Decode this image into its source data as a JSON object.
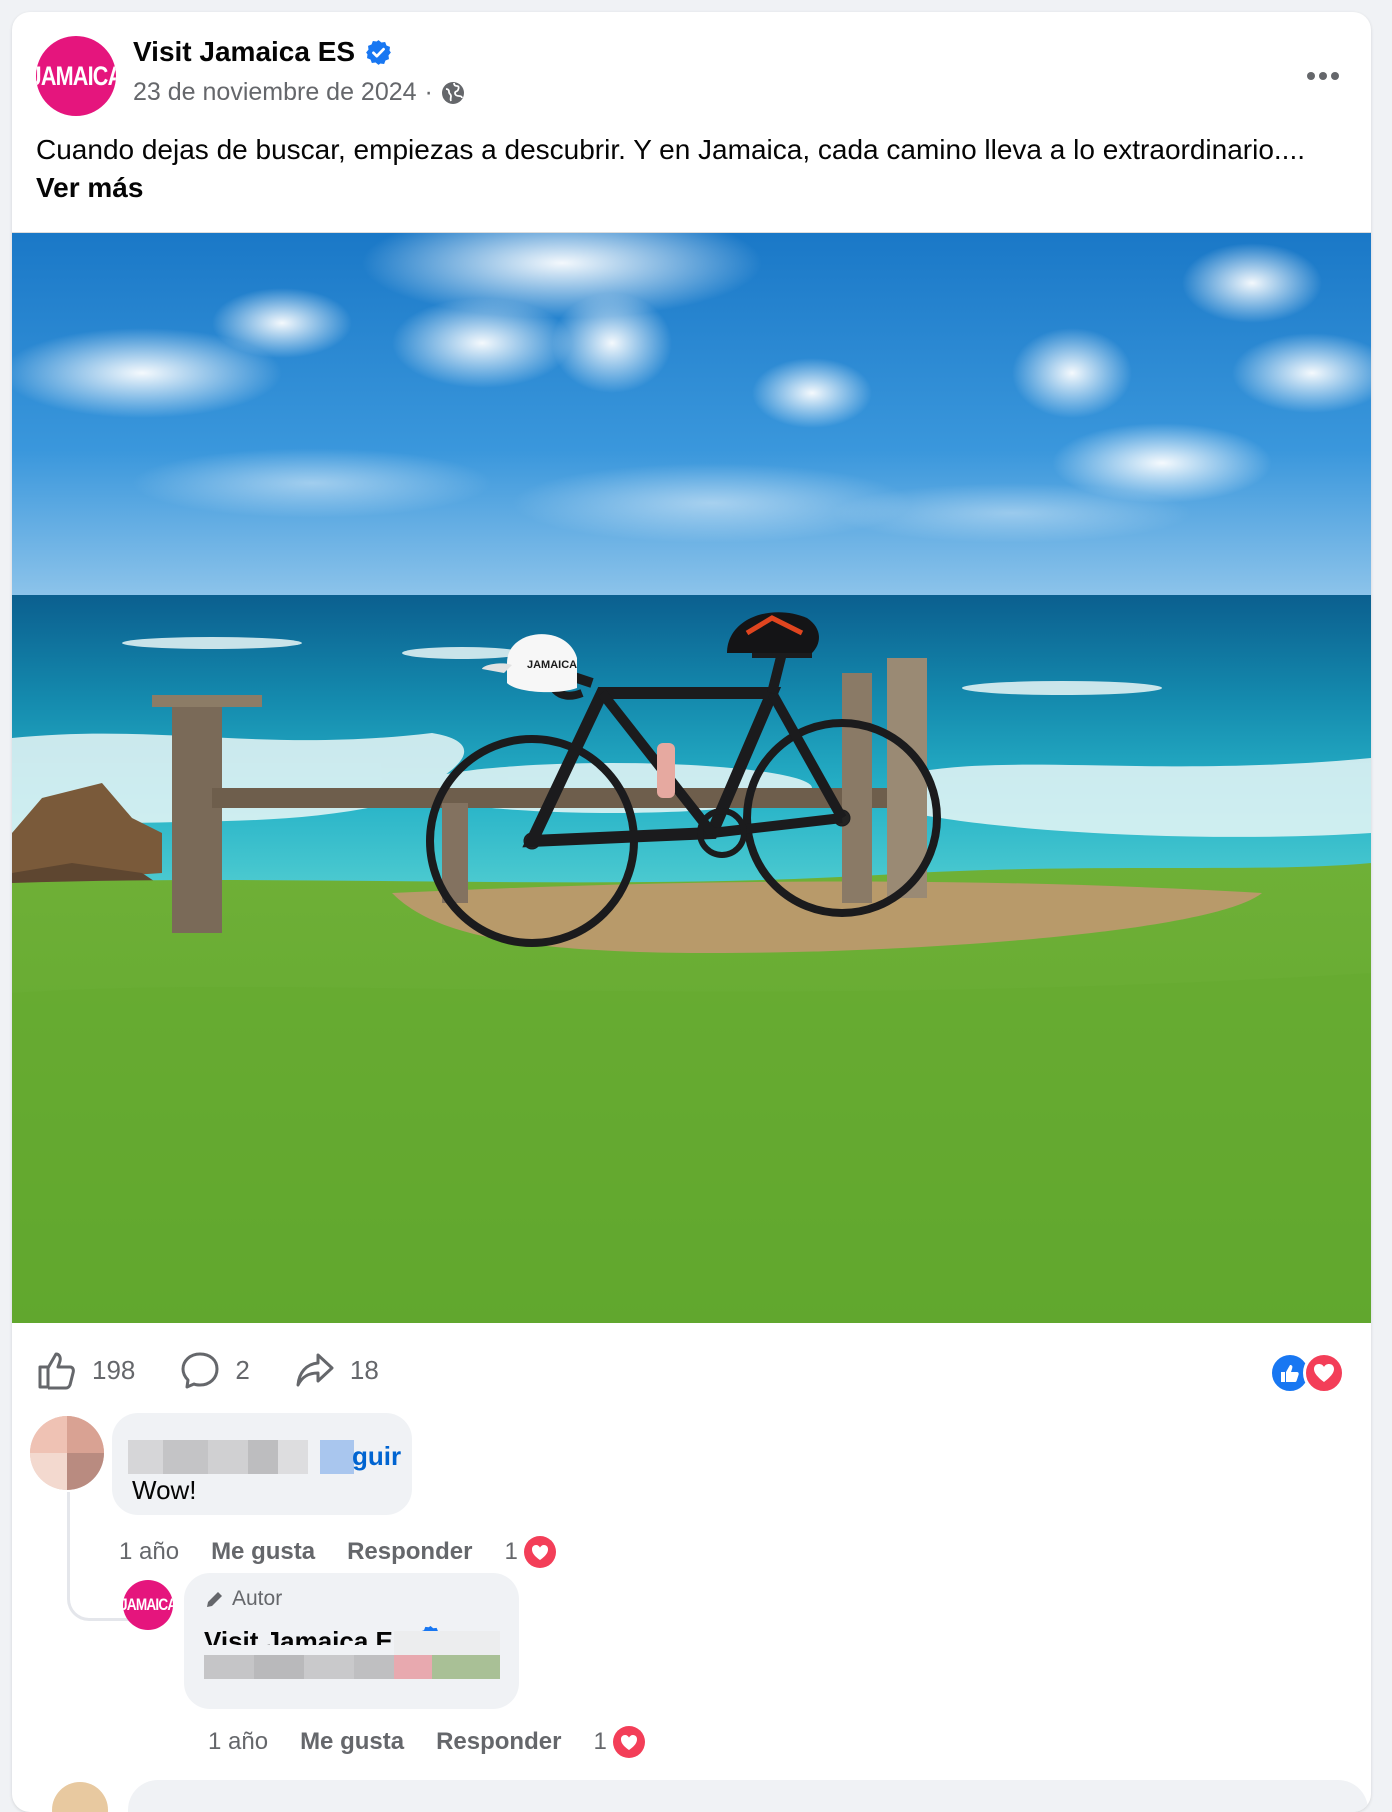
{
  "post": {
    "page_name": "Visit Jamaica ES",
    "avatar_text": "JAMAICA",
    "date": "23 de noviembre de 2024",
    "separator": "·",
    "text": "Cuando dejas de buscar, empiezas a descubrir. Y en Jamaica, cada camino lleva a lo extraordinario....",
    "see_more": "Ver más",
    "photo_cap_text": "JAMAICA"
  },
  "actions": {
    "likes": "198",
    "comments": "2",
    "shares": "18"
  },
  "colors": {
    "brand_pink": "#e5157d",
    "like_blue": "#1877f2",
    "love_red": "#f33e58",
    "link_blue": "#0064d1"
  },
  "comments": [
    {
      "follow_suffix": "guir",
      "text": "Wow!",
      "time": "1 año",
      "like_label": "Me gusta",
      "reply_label": "Responder",
      "reaction_count": "1"
    },
    {
      "author_tag": "Autor",
      "name": "Visit Jamaica ES",
      "avatar_text": "JAMAICA",
      "time": "1 año",
      "like_label": "Me gusta",
      "reply_label": "Responder",
      "reaction_count": "1"
    }
  ]
}
